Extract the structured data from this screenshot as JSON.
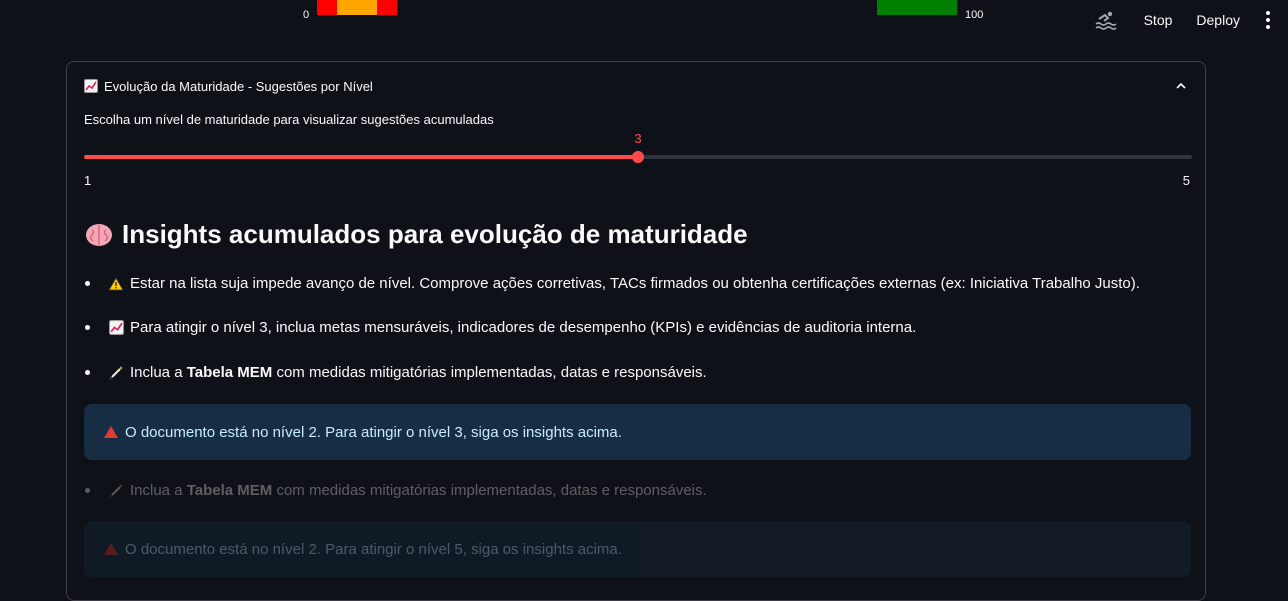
{
  "top_strip": {
    "left_label": "0",
    "right_label": "100"
  },
  "toolbar": {
    "stop_label": "Stop",
    "deploy_label": "Deploy",
    "running_icon": "swimmer-icon",
    "menu_icon": "kebab-menu-icon"
  },
  "expander": {
    "icon": "chart-increasing-icon",
    "title": "Evolução da Maturidade - Sugestões por Nível",
    "slider": {
      "label": "Escolha um nível de maturidade para visualizar sugestões acumuladas",
      "value": "3",
      "min": "1",
      "max": "5",
      "fraction": 0.5
    },
    "heading": "Insights acumulados para evolução de maturidade",
    "heading_icon": "brain-icon",
    "insights": [
      {
        "icon": "warning-icon",
        "text": "Estar na lista suja impede avanço de nível. Comprove ações corretivas, TACs firmados ou obtenha certificações externas (ex: Iniciativa Trabalho Justo)."
      },
      {
        "icon": "chart-increasing-icon",
        "text": "Para atingir o nível 3, inclua metas mensuráveis, indicadores de desempenho (KPIs) e evidências de auditoria interna."
      },
      {
        "icon": "magic-wand-icon",
        "pre": "Inclua a ",
        "bold": "Tabela MEM",
        "post": " com medidas mitigatórias implementadas, datas e responsáveis."
      }
    ],
    "info_alert": "O documento está no nível 2. Para atingir o nível 3, siga os insights acima.",
    "stale": {
      "insight": {
        "icon": "magic-wand-icon",
        "pre": "Inclua a ",
        "bold": "Tabela MEM",
        "post": " com medidas mitigatórias implementadas, datas e responsáveis."
      },
      "info_alert": "O documento está no nível 2. Para atingir o nível 5, siga os insights acima."
    }
  },
  "colors": {
    "accent": "#ff4b4b",
    "background": "#0e1117",
    "info_bg": "#172d43",
    "info_text": "#c7ebff"
  }
}
